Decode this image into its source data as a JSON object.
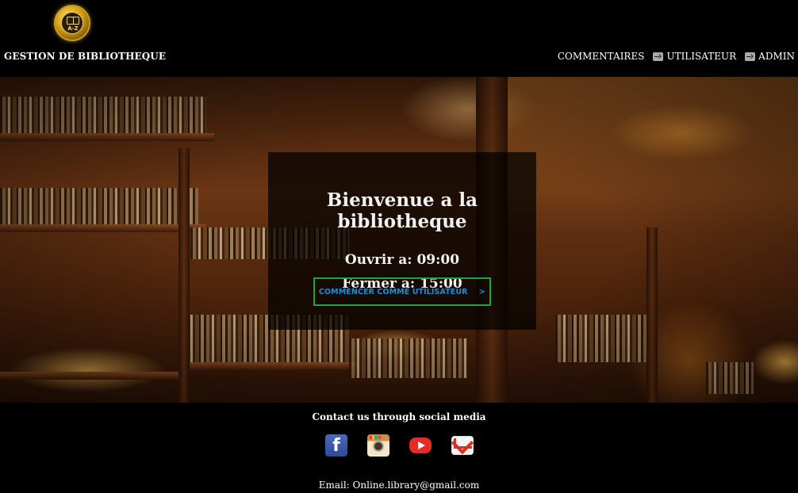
{
  "header": {
    "logo_text": "A-Z",
    "brand": "GESTION DE BIBLIOTHEQUE",
    "nav": [
      {
        "label": "COMMENTAIRES",
        "icon": null
      },
      {
        "label": "UTILISATEUR",
        "icon": "login-icon"
      },
      {
        "label": "ADMIN",
        "icon": "login-icon"
      }
    ]
  },
  "hero": {
    "title": "Bienvenue a la bibliotheque",
    "open": "Ouvrir a: 09:00",
    "close": "Fermer a: 15:00",
    "cta_label": "COMMENCER COMME UTILISATEUR",
    "cta_arrow": ">"
  },
  "footer": {
    "title": "Contact us through social media",
    "socials": [
      "facebook-icon",
      "instagram-icon",
      "youtube-icon",
      "gmail-icon"
    ],
    "email": "Email:  Online.library@gmail.com"
  },
  "colors": {
    "cta_border": "#1fa33a",
    "cta_text": "#1d8fd1",
    "background": "#000000"
  }
}
